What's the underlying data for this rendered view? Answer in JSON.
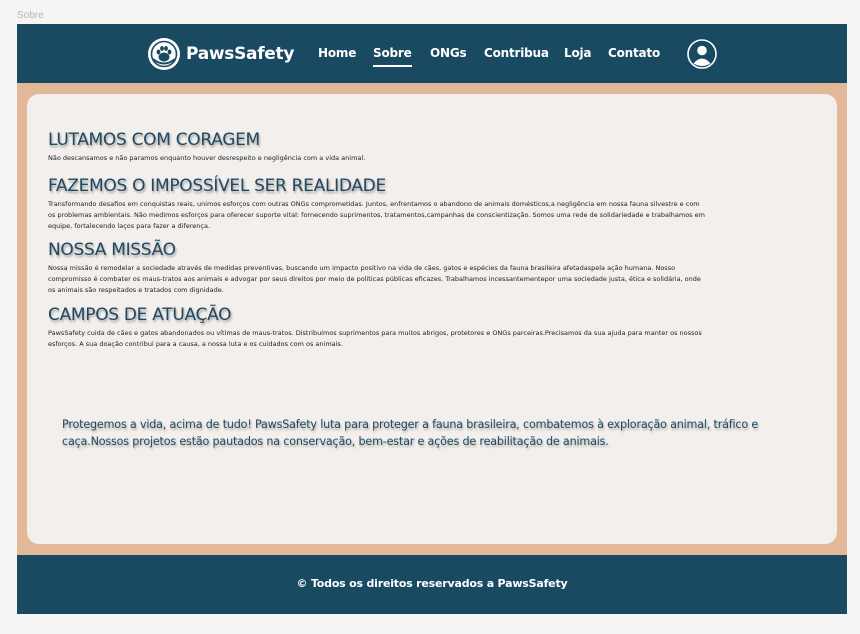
{
  "frame": {
    "label": "Sobre"
  },
  "header": {
    "logo_text": "PawsSafety",
    "nav": [
      {
        "label": "Home",
        "active": false
      },
      {
        "label": "Sobre",
        "active": true
      },
      {
        "label": "ONGs",
        "active": false
      },
      {
        "label": "Contribua",
        "active": false
      },
      {
        "label": "Loja",
        "active": false
      },
      {
        "label": "Contato",
        "active": false
      }
    ],
    "user_icon": "user-avatar-icon"
  },
  "sections": [
    {
      "title": "LUTAMOS COM CORAGEM",
      "body": "Não descansamos e não paramos enquanto houver desrespeito e negligência com a vida animal."
    },
    {
      "title": "FAZEMOS O IMPOSSÍVEL SER REALIDADE",
      "body": "Transformando desafios em conquistas reais, unimos esforços com outras ONGs comprometidas. Juntos, enfrentamos o abandono de animais domésticos,a negligência em nossa fauna silvestre e com os problemas ambientais. Não medimos esforços para oferecer suporte vital: fornecendo suprimentos, tratamentos,campanhas de conscientização. Somos uma rede de solidariedade e trabalhamos em equipe, fortalecendo laços para fazer a diferença."
    },
    {
      "title": "NOSSA MISSÃO",
      "body": "Nossa missão é remodelar a sociedade através de medidas preventivas, buscando um impacto positivo na vida de cães, gatos e espécies da fauna brasileira afetadaspela ação humana. Nosso compromisso é combater os maus-tratos aos animais e advogar por seus direitos por meio de políticas públicas eficazes. Trabalhamos incessantementepor uma sociedade justa, ética e solidária, onde os animais são respeitados e tratados com dignidade."
    },
    {
      "title": "CAMPOS DE ATUAÇÃO",
      "body": "PawsSafety cuida de cães e gatos abandonados ou vítimas de maus-tratos. Distribuímos suprimentos para muitos abrigos, protetores e ONGs parceiras.Precisamos da sua ajuda para manter os nossos esforços. A sua doação contribui para a causa, a nossa luta e os cuidados com os animais."
    }
  ],
  "highlight": "Protegemos a vida, acima de tudo! PawsSafety luta para proteger a fauna brasileira, combatemos à exploração animal, tráfico e caça.Nossos projetos estão pautados na conservação, bem-estar e ações de reabilitação de animais.",
  "footer": {
    "copyright": "© Todos os direitos reservados a PawsSafety"
  },
  "colors": {
    "primary": "#194a62",
    "accent_bg": "#e3b898",
    "card_bg": "#f2efec",
    "heading": "#1f4862"
  }
}
